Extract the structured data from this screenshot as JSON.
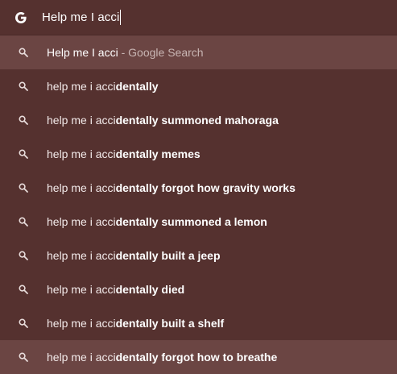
{
  "colors": {
    "background": "#55312f",
    "highlight": "#6b4543",
    "text": "#f3eaea",
    "muted": "#c9b6b4"
  },
  "omnibox": {
    "icon": "google-g-icon",
    "value": "Help me I acci"
  },
  "top_suggestion": {
    "icon": "search-icon",
    "query": "Help me I acci",
    "separator": " - ",
    "source": "Google Search"
  },
  "suggestions": [
    {
      "icon": "search-icon",
      "typed": "help me i acci",
      "completion": "dentally"
    },
    {
      "icon": "search-icon",
      "typed": "help me i acci",
      "completion": "dentally summoned mahoraga"
    },
    {
      "icon": "search-icon",
      "typed": "help me i acci",
      "completion": "dentally memes"
    },
    {
      "icon": "search-icon",
      "typed": "help me i acci",
      "completion": "dentally forgot how gravity works"
    },
    {
      "icon": "search-icon",
      "typed": "help me i acci",
      "completion": "dentally summoned a lemon"
    },
    {
      "icon": "search-icon",
      "typed": "help me i acci",
      "completion": "dentally built a jeep"
    },
    {
      "icon": "search-icon",
      "typed": "help me i acci",
      "completion": "dentally died"
    },
    {
      "icon": "search-icon",
      "typed": "help me i acci",
      "completion": "dentally built a shelf"
    },
    {
      "icon": "search-icon",
      "typed": "help me i acci",
      "completion": "dentally forgot how to breathe"
    }
  ]
}
